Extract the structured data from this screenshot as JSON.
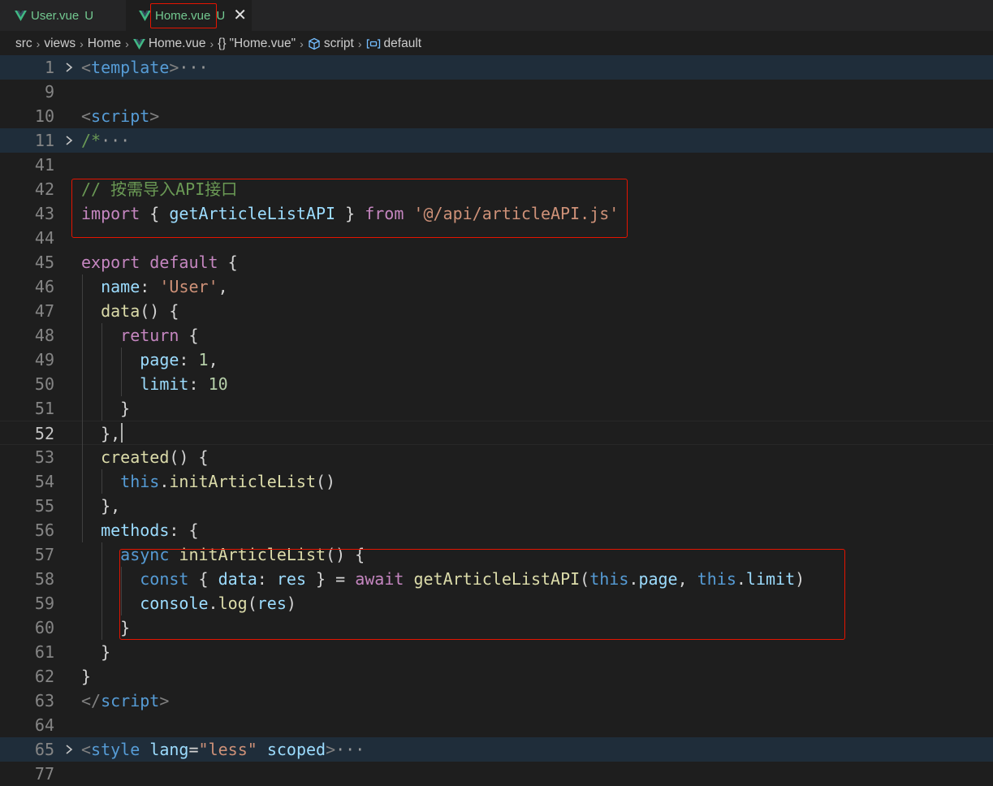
{
  "tabs": [
    {
      "label": "User.vue",
      "status": "U",
      "active": false
    },
    {
      "label": "Home.vue",
      "status": "U",
      "active": true,
      "close": "✕"
    }
  ],
  "breadcrumb": {
    "segments": [
      "src",
      "views",
      "Home",
      "Home.vue",
      "\"Home.vue\"",
      "script",
      "default"
    ],
    "icons": [
      "",
      "",
      "",
      "vue-icon",
      "braces-icon",
      "cube-icon",
      "symbol-variable-icon"
    ],
    "braces_glyph": "{}"
  },
  "colors": {
    "keyword_purple": "#c586c0",
    "keyword_blue": "#569cd6",
    "tag": "#569cd6",
    "bracket": "#808080",
    "string": "#ce9178",
    "comment": "#6a9955",
    "number": "#b5cea8",
    "property": "#9cdcfe",
    "function": "#dcdcaa",
    "default_text": "#d4d4d4",
    "vue_green": "#41b883",
    "untracked": "#73c991",
    "annotation_red": "#e51400"
  },
  "editor": {
    "active_line": "52",
    "lines": [
      {
        "n": "1",
        "fold": true,
        "folded": true,
        "tokens": [
          [
            "<",
            "bracket"
          ],
          [
            "template",
            "tag"
          ],
          [
            ">",
            "bracket"
          ],
          [
            "···",
            "ellipsis"
          ]
        ]
      },
      {
        "n": "9",
        "tokens": []
      },
      {
        "n": "10",
        "tokens": [
          [
            "<",
            "bracket"
          ],
          [
            "script",
            "tag"
          ],
          [
            ">",
            "bracket"
          ]
        ]
      },
      {
        "n": "11",
        "fold": true,
        "folded": true,
        "tokens": [
          [
            "/*",
            "comment"
          ],
          [
            "···",
            "ellipsis"
          ]
        ]
      },
      {
        "n": "41",
        "tokens": []
      },
      {
        "n": "42",
        "tokens": [
          [
            "// 按需导入API接口",
            "comment"
          ]
        ]
      },
      {
        "n": "43",
        "tokens": [
          [
            "import",
            "keyword_purple"
          ],
          [
            " { ",
            "default_text"
          ],
          [
            "getArticleListAPI",
            "property"
          ],
          [
            " } ",
            "default_text"
          ],
          [
            "from",
            "keyword_purple"
          ],
          [
            " ",
            "default_text"
          ],
          [
            "'@/api/articleAPI.js'",
            "string"
          ]
        ]
      },
      {
        "n": "44",
        "tokens": []
      },
      {
        "n": "45",
        "tokens": [
          [
            "export",
            "keyword_purple"
          ],
          [
            " ",
            "default_text"
          ],
          [
            "default",
            "keyword_purple"
          ],
          [
            " {",
            "default_text"
          ]
        ]
      },
      {
        "n": "46",
        "tokens": [
          [
            "  ",
            "default_text"
          ],
          [
            "name",
            "property"
          ],
          [
            ": ",
            "default_text"
          ],
          [
            "'User'",
            "string"
          ],
          [
            ",",
            "default_text"
          ]
        ]
      },
      {
        "n": "47",
        "tokens": [
          [
            "  ",
            "default_text"
          ],
          [
            "data",
            "function"
          ],
          [
            "() {",
            "default_text"
          ]
        ]
      },
      {
        "n": "48",
        "tokens": [
          [
            "    ",
            "default_text"
          ],
          [
            "return",
            "keyword_purple"
          ],
          [
            " {",
            "default_text"
          ]
        ]
      },
      {
        "n": "49",
        "tokens": [
          [
            "      ",
            "default_text"
          ],
          [
            "page",
            "property"
          ],
          [
            ": ",
            "default_text"
          ],
          [
            "1",
            "number"
          ],
          [
            ",",
            "default_text"
          ]
        ]
      },
      {
        "n": "50",
        "tokens": [
          [
            "      ",
            "default_text"
          ],
          [
            "limit",
            "property"
          ],
          [
            ": ",
            "default_text"
          ],
          [
            "10",
            "number"
          ]
        ]
      },
      {
        "n": "51",
        "tokens": [
          [
            "    }",
            "default_text"
          ]
        ]
      },
      {
        "n": "52",
        "tokens": [
          [
            "  },",
            "default_text"
          ]
        ]
      },
      {
        "n": "53",
        "tokens": [
          [
            "  ",
            "default_text"
          ],
          [
            "created",
            "function"
          ],
          [
            "() {",
            "default_text"
          ]
        ]
      },
      {
        "n": "54",
        "tokens": [
          [
            "    ",
            "default_text"
          ],
          [
            "this",
            "keyword_blue"
          ],
          [
            ".",
            "default_text"
          ],
          [
            "initArticleList",
            "function"
          ],
          [
            "()",
            "default_text"
          ]
        ]
      },
      {
        "n": "55",
        "tokens": [
          [
            "  },",
            "default_text"
          ]
        ]
      },
      {
        "n": "56",
        "tokens": [
          [
            "  ",
            "default_text"
          ],
          [
            "methods",
            "property"
          ],
          [
            ": {",
            "default_text"
          ]
        ]
      },
      {
        "n": "57",
        "tokens": [
          [
            "    ",
            "default_text"
          ],
          [
            "async",
            "keyword_blue"
          ],
          [
            " ",
            "default_text"
          ],
          [
            "initArticleList",
            "function"
          ],
          [
            "() {",
            "default_text"
          ]
        ]
      },
      {
        "n": "58",
        "tokens": [
          [
            "      ",
            "default_text"
          ],
          [
            "const",
            "keyword_blue"
          ],
          [
            " { ",
            "default_text"
          ],
          [
            "data",
            "property"
          ],
          [
            ": ",
            "default_text"
          ],
          [
            "res",
            "property"
          ],
          [
            " } = ",
            "default_text"
          ],
          [
            "await",
            "keyword_purple"
          ],
          [
            " ",
            "default_text"
          ],
          [
            "getArticleListAPI",
            "function"
          ],
          [
            "(",
            "default_text"
          ],
          [
            "this",
            "keyword_blue"
          ],
          [
            ".",
            "default_text"
          ],
          [
            "page",
            "property"
          ],
          [
            ", ",
            "default_text"
          ],
          [
            "this",
            "keyword_blue"
          ],
          [
            ".",
            "default_text"
          ],
          [
            "limit",
            "property"
          ],
          [
            ")",
            "default_text"
          ]
        ]
      },
      {
        "n": "59",
        "tokens": [
          [
            "      ",
            "default_text"
          ],
          [
            "console",
            "property"
          ],
          [
            ".",
            "default_text"
          ],
          [
            "log",
            "function"
          ],
          [
            "(",
            "default_text"
          ],
          [
            "res",
            "property"
          ],
          [
            ")",
            "default_text"
          ]
        ]
      },
      {
        "n": "60",
        "tokens": [
          [
            "    }",
            "default_text"
          ]
        ]
      },
      {
        "n": "61",
        "tokens": [
          [
            "  }",
            "default_text"
          ]
        ]
      },
      {
        "n": "62",
        "tokens": [
          [
            "}",
            "default_text"
          ]
        ]
      },
      {
        "n": "63",
        "tokens": [
          [
            "</",
            "bracket"
          ],
          [
            "script",
            "tag"
          ],
          [
            ">",
            "bracket"
          ]
        ]
      },
      {
        "n": "64",
        "tokens": []
      },
      {
        "n": "65",
        "fold": true,
        "folded": true,
        "tokens": [
          [
            "<",
            "bracket"
          ],
          [
            "style",
            "tag"
          ],
          [
            " ",
            "default_text"
          ],
          [
            "lang",
            "property"
          ],
          [
            "=",
            "default_text"
          ],
          [
            "\"less\"",
            "string"
          ],
          [
            " ",
            "default_text"
          ],
          [
            "scoped",
            "property"
          ],
          [
            ">",
            "bracket"
          ],
          [
            "···",
            "ellipsis"
          ]
        ]
      },
      {
        "n": "77",
        "tokens": []
      }
    ]
  }
}
